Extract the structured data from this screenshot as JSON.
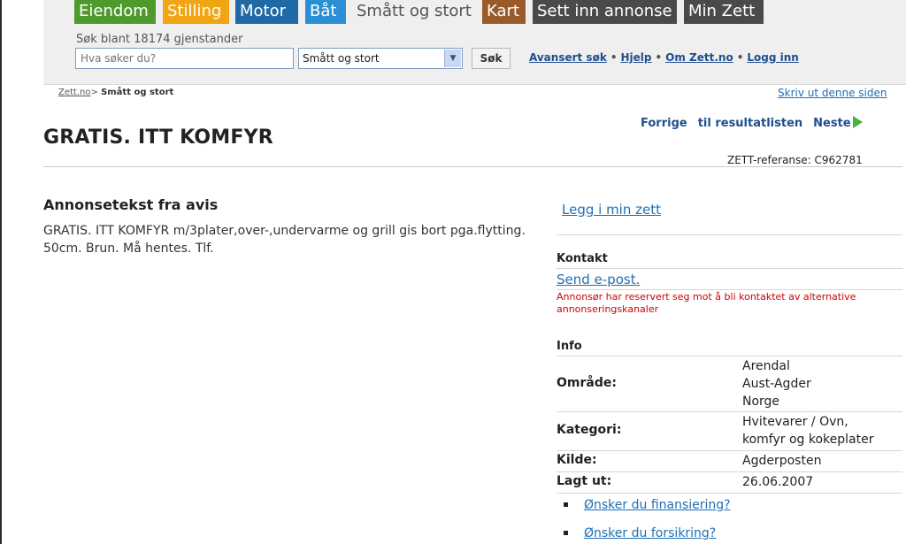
{
  "nav": {
    "tabs": [
      {
        "label": "Eiendom",
        "color": "#4f9a2c"
      },
      {
        "label": "Stilling",
        "color": "#f0a512"
      },
      {
        "label": "Motor",
        "color": "#1f6aa6"
      },
      {
        "label": "Båt",
        "color": "#2b8fd6"
      },
      {
        "label": "Smått og stort",
        "color": "#efefef"
      },
      {
        "label": "Kart",
        "color": "#9a5a2a"
      },
      {
        "label": "Sett inn annonse",
        "color": "#4a4a4a"
      },
      {
        "label": "Min Zett",
        "color": "#4a4a4a"
      }
    ]
  },
  "search": {
    "count_label": "Søk blant 18174 gjenstander",
    "placeholder": "Hva søker du?",
    "category_selected": "Smått og stort",
    "button_label": "Søk",
    "links": [
      "Avansert søk",
      "Hjelp",
      "Om Zett.no",
      "Logg inn"
    ],
    "separator": "•"
  },
  "breadcrumb": {
    "home": "Zett.no",
    "sep": ">",
    "current": "Smått og stort"
  },
  "print_link": "Skriv ut denne siden",
  "result_nav": {
    "prev": "Forrige",
    "results": "til resultatlisten",
    "next": "Neste"
  },
  "ad": {
    "title": "GRATIS. ITT KOMFYR",
    "reference": "ZETT-referanse: C962781",
    "text_heading": "Annonsetekst fra avis",
    "text": "GRATIS. ITT KOMFYR m/3plater,over-,undervarme og grill gis bort pga.flytting. 50cm. Brun. Må hentes. Tlf."
  },
  "sidebar": {
    "save_link": "Legg i min zett",
    "contact": {
      "title": "Kontakt",
      "email_link": "Send e-post.",
      "notice": "Annonsør har reservert seg mot å bli kontaktet av alternative annonseringskanaler"
    },
    "info": {
      "title": "Info",
      "area_label": "Område:",
      "area_values": [
        "Arendal",
        "Aust-Agder",
        "Norge"
      ],
      "category_label": "Kategori:",
      "category_values": [
        "Hvitevarer / Ovn,",
        "komfyr og kokeplater"
      ],
      "source_label": "Kilde:",
      "source_value": "Agderposten",
      "posted_label": "Lagt ut:",
      "posted_value": "26.06.2007"
    },
    "extra_links": [
      "Ønsker du finansiering?",
      "Ønsker du forsikring?"
    ]
  }
}
